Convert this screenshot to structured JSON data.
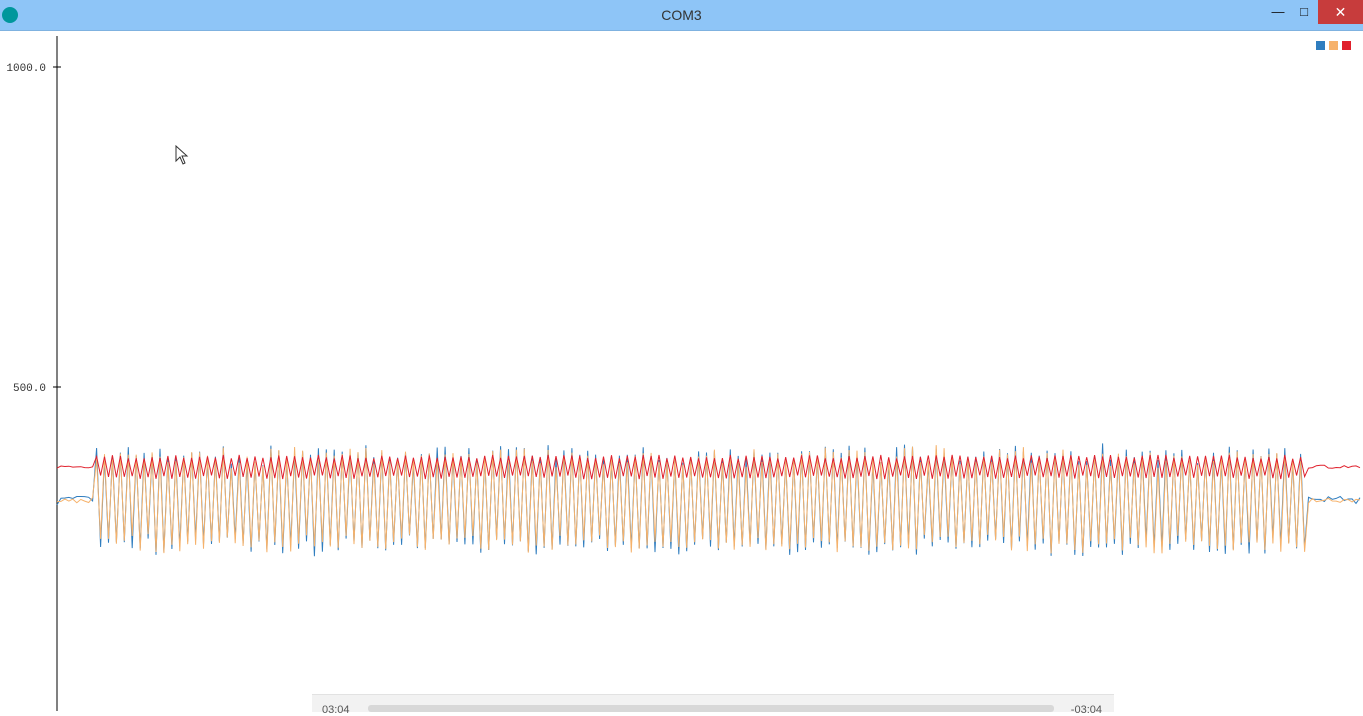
{
  "window": {
    "title": "COM3",
    "icon": "arduino-logo-icon",
    "controls": {
      "minimize": "—",
      "maximize": "□",
      "close": "✕"
    }
  },
  "legend": {
    "swatches": [
      {
        "color": "#2f7dbf"
      },
      {
        "color": "#f6b26b"
      },
      {
        "color": "#e0202c"
      }
    ]
  },
  "chart_data": {
    "type": "line",
    "ylim": [
      0,
      1000
    ],
    "yticks": [
      1000.0,
      500.0
    ],
    "ytick_labels": [
      "1000.0",
      "500.0"
    ],
    "grid": false,
    "legend_placement": "top-right",
    "series": [
      {
        "color": "#2f7dbf",
        "baseline": 323,
        "amplitude": 82
      },
      {
        "color": "#f6b26b",
        "baseline": 323,
        "amplitude": 78
      },
      {
        "color": "#e0202c",
        "baseline": 375,
        "amplitude": 13
      }
    ]
  },
  "playback": {
    "time_elapsed": "03:04",
    "time_remaining": "-03:04",
    "progress": 0
  },
  "colors": {
    "titlebar": "#8ec5f7",
    "close_button": "#c73c3c"
  }
}
